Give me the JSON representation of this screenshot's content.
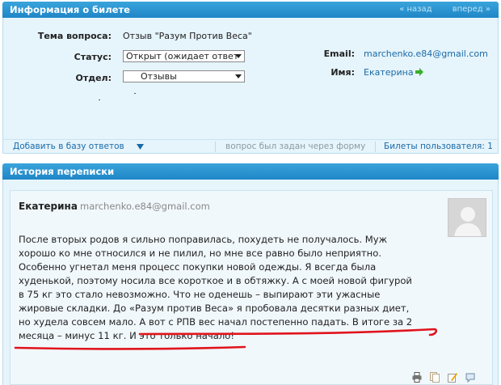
{
  "ticket_panel": {
    "title": "Информация о билете",
    "nav_back": "« назад",
    "nav_forward": "вперед »"
  },
  "fields": {
    "subject_label": "Тема вопроса:",
    "subject_value": "Отзыв \"Разум Против Веса\"",
    "status_label": "Статус:",
    "status_value": "Открыт (ожидает ответ",
    "department_label": "Отдел:",
    "department_value": "Отзывы",
    "email_label": "Email:",
    "email_value": "marchenko.e84@gmail.com",
    "name_label": "Имя:",
    "name_value": "Екатерина"
  },
  "toolbar": {
    "add_to_base": "Добавить в базу ответов",
    "asked_via_form": "вопрос был задан через форму",
    "user_tickets": "Билеты пользователя: 1"
  },
  "history_panel": {
    "title": "История переписки"
  },
  "message": {
    "author": "Екатерина",
    "email": "marchenko.e84@gmail.com",
    "lines": [
      "После вторых родов я сильно поправилась, похудеть не получалось. Муж",
      "хорошо ко мне относился и не пилил, но мне все равно было неприятно.",
      "Особенно угнетал меня процесс покупки новой одежды. Я всегда была",
      "худенькой, поэтому носила все короткое и в обтяжку. А с моей новой фигурой",
      "в 75 кг это стало невозможно. Что не оденешь – выпирают эти ужасные",
      "жировые складки. До «Разум против Веса» я пробовала десятки разных диет,",
      "но худела совсем мало. А вот с РПВ вес начал постепенно падать. В итоге за 2",
      "месяца – минус 11 кг. И это только начало!"
    ]
  },
  "colors": {
    "header": "#2792d0",
    "panel_bg": "#e6f4fb",
    "link": "#1a6aa8",
    "underline": "#e0141c",
    "green_arrow": "#3cae2c"
  }
}
